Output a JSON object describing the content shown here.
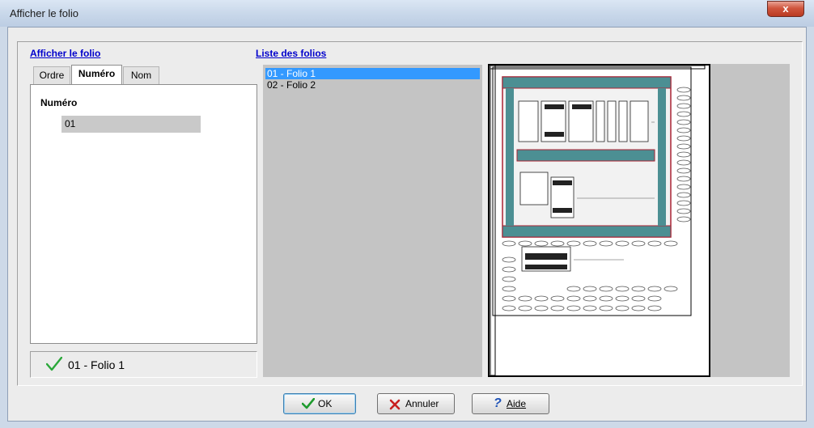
{
  "window": {
    "title": "Afficher le folio",
    "close_label": "x"
  },
  "left_panel": {
    "header": "Afficher le folio",
    "tabs": [
      {
        "label": "Ordre"
      },
      {
        "label": "Numéro"
      },
      {
        "label": "Nom"
      }
    ],
    "field_label": "Numéro",
    "field_value": "01",
    "status_text": "01 - Folio 1"
  },
  "list_panel": {
    "header": "Liste des folios",
    "items": [
      {
        "label": "01 - Folio 1",
        "selected": true
      },
      {
        "label": "02 - Folio 2",
        "selected": false
      }
    ]
  },
  "buttons": {
    "ok": "OK",
    "cancel": "Annuler",
    "help": "Aide"
  },
  "colors": {
    "link": "#0000cc",
    "selection": "#3399ff",
    "accent_teal": "#4c8f93",
    "check": "#2aa83a",
    "close": "#c8432a"
  },
  "icons": [
    "close-icon",
    "check-icon",
    "checkmark-icon",
    "x-icon",
    "help-icon"
  ]
}
